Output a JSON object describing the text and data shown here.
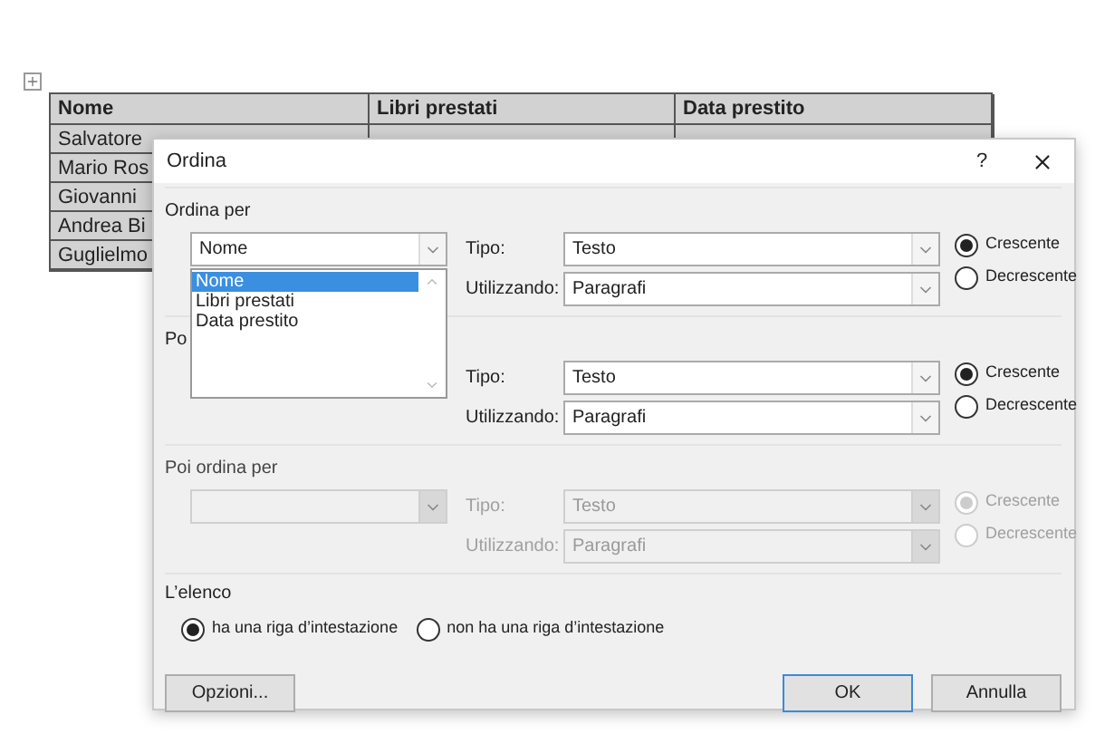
{
  "table": {
    "columns": [
      "Nome",
      "Libri prestati",
      "Data prestito"
    ],
    "rows": [
      [
        "Salvatore"
      ],
      [
        "Mario Ros"
      ],
      [
        "Giovanni"
      ],
      [
        "Andrea Bi"
      ],
      [
        "Guglielmo"
      ]
    ]
  },
  "dialog": {
    "title": "Ordina",
    "help": "?",
    "sort_levels": [
      {
        "heading": "Ordina per",
        "field_value": "Nome",
        "disabled": false,
        "tipo_label": "Tipo:",
        "tipo_value": "Testo",
        "using_label": "Utilizzando:",
        "using_value": "Paragrafi",
        "orders": [
          {
            "label": "Crescente",
            "selected": true
          },
          {
            "label": "Decrescente",
            "selected": false
          }
        ]
      },
      {
        "heading": "Po",
        "disabled": false,
        "tipo_label": "Tipo:",
        "tipo_value": "Testo",
        "using_label": "Utilizzando:",
        "using_value": "Paragrafi",
        "orders": [
          {
            "label": "Crescente",
            "selected": true
          },
          {
            "label": "Decrescente",
            "selected": false
          }
        ]
      },
      {
        "heading": "Poi ordina per",
        "disabled": true,
        "tipo_label": "Tipo:",
        "tipo_value": "Testo",
        "using_label": "Utilizzando:",
        "using_value": "Paragrafi",
        "orders": [
          {
            "label": "Crescente",
            "selected": true
          },
          {
            "label": "Decrescente",
            "selected": false
          }
        ]
      }
    ],
    "dropdown": {
      "options": [
        {
          "label": "Nome",
          "selected": true
        },
        {
          "label": "Libri prestati",
          "selected": false
        },
        {
          "label": "Data prestito",
          "selected": false
        }
      ]
    },
    "list_header": {
      "heading": "L’elenco",
      "options": [
        {
          "label": "ha una riga d’intestazione",
          "selected": true
        },
        {
          "label": "non ha una riga d’intestazione",
          "selected": false
        }
      ]
    },
    "buttons": [
      {
        "label": "Opzioni...",
        "default": false
      },
      {
        "label": "OK",
        "default": true
      },
      {
        "label": "Annulla",
        "default": false
      }
    ]
  }
}
